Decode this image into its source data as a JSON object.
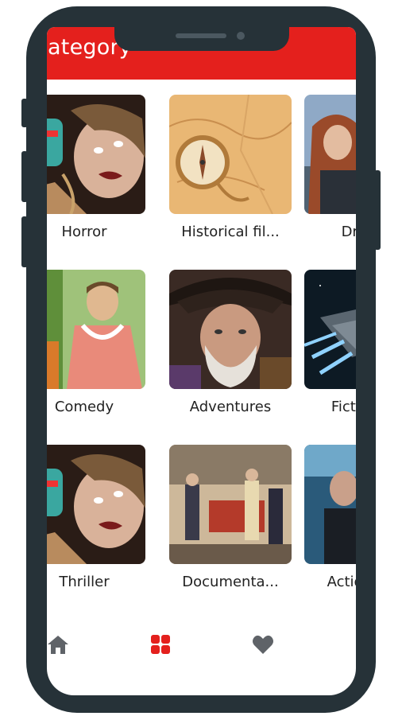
{
  "app_bar": {
    "title": "Category"
  },
  "categories": [
    {
      "label": "Horror",
      "icon": "horror-thumbnail"
    },
    {
      "label": "Historical fil...",
      "icon": "historical-thumbnail"
    },
    {
      "label": "Drama",
      "icon": "drama-thumbnail"
    },
    {
      "label": "Comedy",
      "icon": "comedy-thumbnail"
    },
    {
      "label": "Adventures",
      "icon": "adventures-thumbnail"
    },
    {
      "label": "Fiction f...",
      "icon": "fiction-thumbnail"
    },
    {
      "label": "Thriller",
      "icon": "thriller-thumbnail"
    },
    {
      "label": "Documenta...",
      "icon": "documentary-thumbnail"
    },
    {
      "label": "Action m...",
      "icon": "action-thumbnail"
    }
  ],
  "bottom_nav": {
    "items": [
      {
        "icon": "home-icon",
        "active": false
      },
      {
        "icon": "grid-icon",
        "active": true
      },
      {
        "icon": "heart-icon",
        "active": false
      }
    ]
  },
  "colors": {
    "accent": "#e4201d",
    "frame": "#263238",
    "inactive_icon": "#5f6368"
  }
}
